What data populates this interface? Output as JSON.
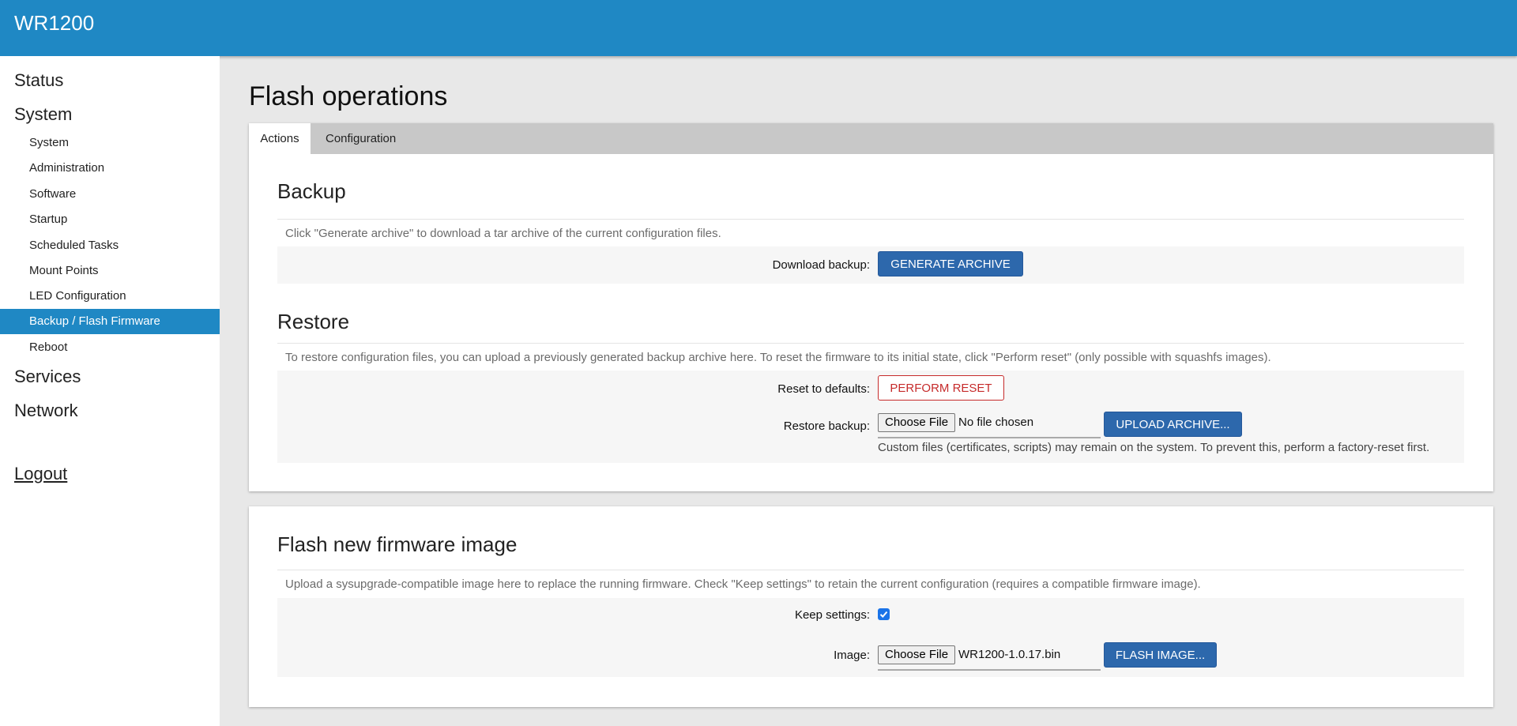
{
  "header": {
    "brand": "WR1200"
  },
  "sidebar": {
    "top": [
      {
        "label": "Status"
      },
      {
        "label": "System"
      }
    ],
    "system_items": [
      {
        "label": "System"
      },
      {
        "label": "Administration"
      },
      {
        "label": "Software"
      },
      {
        "label": "Startup"
      },
      {
        "label": "Scheduled Tasks"
      },
      {
        "label": "Mount Points"
      },
      {
        "label": "LED Configuration"
      },
      {
        "label": "Backup / Flash Firmware"
      },
      {
        "label": "Reboot"
      }
    ],
    "bottom": [
      {
        "label": "Services"
      },
      {
        "label": "Network"
      }
    ],
    "logout": "Logout"
  },
  "page": {
    "title": "Flash operations"
  },
  "tabs": [
    {
      "label": "Actions"
    },
    {
      "label": "Configuration"
    }
  ],
  "backup": {
    "title": "Backup",
    "description": "Click \"Generate archive\" to download a tar archive of the current configuration files.",
    "download_label": "Download backup:",
    "generate_button": "GENERATE ARCHIVE"
  },
  "restore": {
    "title": "Restore",
    "description": "To restore configuration files, you can upload a previously generated backup archive here. To reset the firmware to its initial state, click \"Perform reset\" (only possible with squashfs images).",
    "reset_label": "Reset to defaults:",
    "reset_button": "PERFORM RESET",
    "restore_label": "Restore backup:",
    "choose_file": "Choose File",
    "file_name": "No file chosen",
    "upload_button": "UPLOAD ARCHIVE...",
    "note": "Custom files (certificates, scripts) may remain on the system. To prevent this, perform a factory-reset first."
  },
  "flash": {
    "title": "Flash new firmware image",
    "description": "Upload a sysupgrade-compatible image here to replace the running firmware. Check \"Keep settings\" to retain the current configuration (requires a compatible firmware image).",
    "keep_label": "Keep settings:",
    "keep_checked": true,
    "image_label": "Image:",
    "choose_file": "Choose File",
    "file_name": "WR1200-1.0.17.bin",
    "flash_button": "FLASH IMAGE..."
  }
}
